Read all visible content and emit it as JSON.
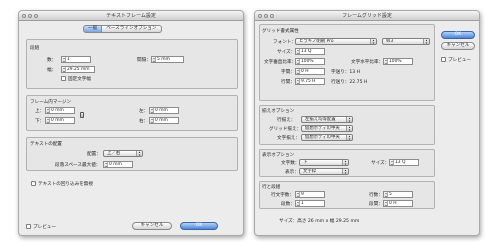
{
  "dialog1": {
    "title": "テキストフレーム設定",
    "tabs": [
      "一般",
      "ベースラインオプション"
    ],
    "columns": {
      "group_label": "段組",
      "count_label": "数：",
      "count_value": "1",
      "gutter_label": "間隔：",
      "gutter_value": "5 mm",
      "width_label": "幅：",
      "width_value": "29.25 mm",
      "fixed_width_label": "固定文字幅"
    },
    "inset": {
      "group_label": "フレーム内マージン",
      "top_label": "上：",
      "top_value": "0 mm",
      "bottom_label": "下：",
      "bottom_value": "0 mm",
      "left_label": "左：",
      "left_value": "0 mm",
      "right_label": "右：",
      "right_value": "0 mm"
    },
    "vertical": {
      "group_label": "テキストの配置",
      "align_label": "配置：",
      "align_value": "上／右",
      "spacing_label": "段落スペース最大値：",
      "spacing_value": "0 mm"
    },
    "ignore_wrap_label": "テキストの回り込みを無視",
    "preview_label": "プレビュー",
    "cancel_label": "キャンセル",
    "ok_label": "OK"
  },
  "dialog2": {
    "title": "フレームグリッド設定",
    "grid_attr": {
      "group_label": "グリッド書式属性",
      "font_label": "フォント：",
      "font_value": "ヒラギノ明朝 Pro",
      "font_style_value": "W3",
      "size_label": "サイズ：",
      "size_value": "13 Q",
      "vscale_label": "文字垂直比率：",
      "vscale_value": "100%",
      "hscale_label": "文字水平比率：",
      "hscale_value": "100%",
      "charspace_label": "字間：",
      "charspace_value": "0 H",
      "charspace_note": "字送り：13 H",
      "linespace_label": "行間：",
      "linespace_value": "9.75 H",
      "linespace_note": "行送り：22.75 H"
    },
    "alignment": {
      "group_label": "揃えオプション",
      "line_align_label": "行揃え：",
      "line_align_value": "左揃え均等配置",
      "grid_align_label": "グリッド揃え：",
      "grid_align_value": "仮想ボディの中央",
      "char_align_label": "文字揃え：",
      "char_align_value": "仮想ボディの中央"
    },
    "view": {
      "group_label": "表示オプション",
      "count_label": "文字数：",
      "count_value": "下",
      "size_label": "サイズ：",
      "size_value": "13 Q",
      "display_label": "表示：",
      "display_value": "文字枠"
    },
    "lines": {
      "group_label": "行と段組",
      "chars_label": "行文字数：",
      "chars_value": "9",
      "lines_label": "行数：",
      "lines_value": "5",
      "cols_label": "段数：",
      "cols_value": "1",
      "gutter_label": "段間：",
      "gutter_value": "0 H"
    },
    "size_summary": "サイズ：高さ 26 mm x 幅 29.25 mm",
    "ok_label": "OK",
    "cancel_label": "キャンセル",
    "preview_label": "プレビュー"
  },
  "colors": {
    "accent_button": "#4b86d6",
    "window_bg": "#ececec"
  }
}
